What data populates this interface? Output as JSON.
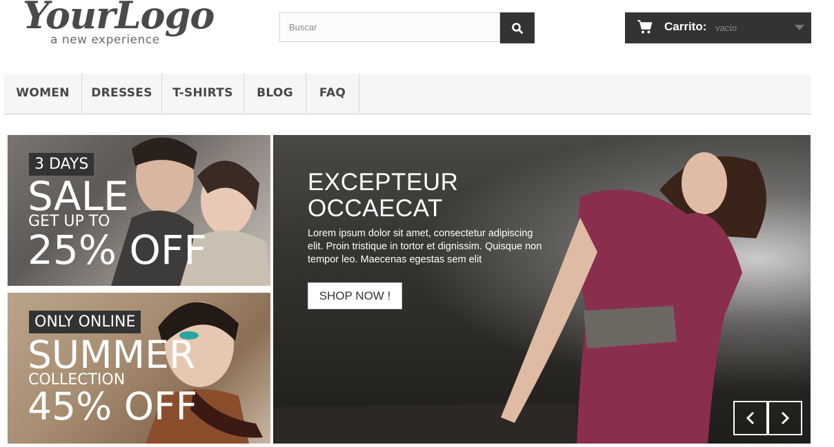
{
  "logo": {
    "main": "YourLogo",
    "tagline": "a new experience"
  },
  "search": {
    "placeholder": "Buscar",
    "icon": "search-icon"
  },
  "cart": {
    "title": "Carrito:",
    "status": "vacío",
    "icon": "shopping-cart-icon"
  },
  "nav": {
    "items": [
      "WOMEN",
      "DRESSES",
      "T-SHIRTS",
      "BLOG",
      "FAQ"
    ]
  },
  "banners": [
    {
      "badge": "3 DAYS",
      "headline": "SALE",
      "subline": "GET UP TO",
      "offer": "25% OFF"
    },
    {
      "badge": "ONLY ONLINE",
      "headline": "SUMMER",
      "subline": "COLLECTION",
      "offer": "45% OFF"
    }
  ],
  "slider": {
    "title": "EXCEPTEUR OCCAECAT",
    "text": "Lorem ipsum dolor sit amet, consectetur adipiscing elit. Proin tristique in tortor et dignissim. Quisque non tempor leo. Maecenas egestas sem elit",
    "button": "SHOP NOW !"
  },
  "colors": {
    "dark": "#333333",
    "nav_bg": "#f6f6f6",
    "slide_dress": "#8a2e4e"
  }
}
